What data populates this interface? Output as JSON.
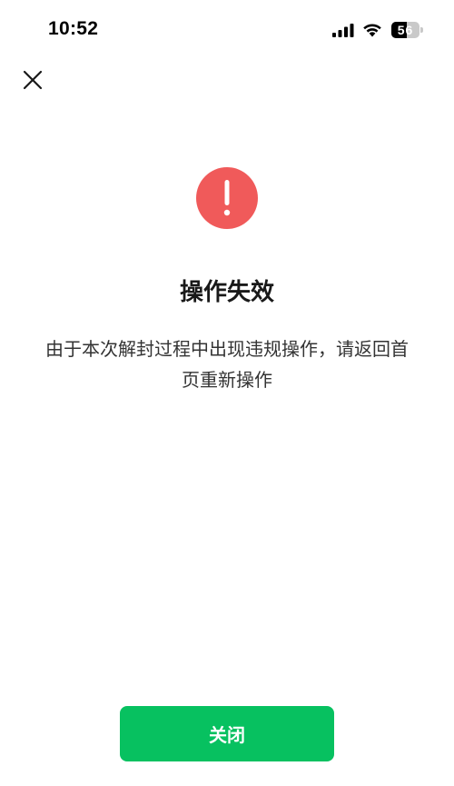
{
  "status_bar": {
    "time": "10:52",
    "battery_level": "56",
    "battery_fraction": 0.56,
    "icons": [
      "cellular-signal-icon",
      "wifi-icon",
      "battery-icon"
    ]
  },
  "nav": {
    "close_icon": "close-icon"
  },
  "result": {
    "icon": "exclamation-icon",
    "icon_color": "#f05a5a",
    "title": "操作失效",
    "message": "由于本次解封过程中出现违规操作，请返回首页重新操作"
  },
  "actions": {
    "close_label": "关闭",
    "button_color": "#07c160"
  }
}
